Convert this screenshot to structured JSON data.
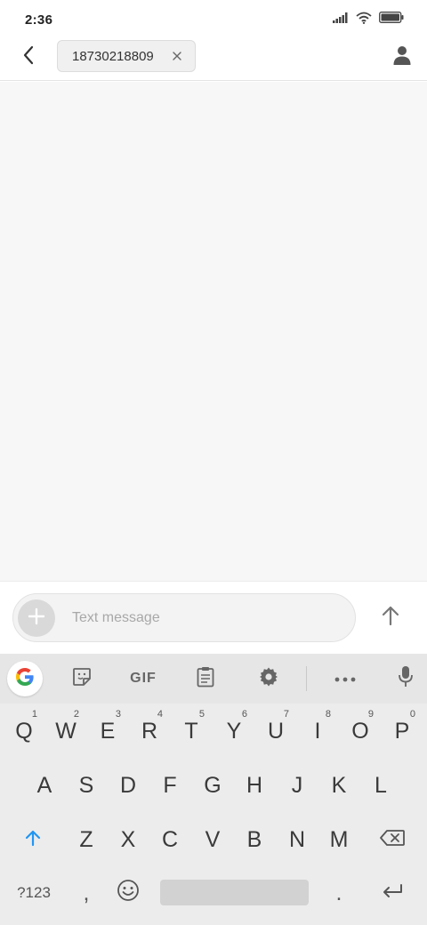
{
  "status_bar": {
    "time": "2:36",
    "icons": [
      "signal-icon",
      "wifi-icon",
      "battery-icon"
    ]
  },
  "header": {
    "back_icon": "back-arrow-icon",
    "recipient": "18730218809",
    "chip_close_icon": "close-icon",
    "contact_icon": "person-icon"
  },
  "composer": {
    "add_icon": "plus-icon",
    "placeholder": "Text message",
    "value": "",
    "send_icon": "arrow-up-icon"
  },
  "keyboard": {
    "toolbar": [
      "google-icon",
      "sticker-icon",
      "gif-icon",
      "clipboard-icon",
      "gear-icon",
      "more-icon",
      "microphone-icon"
    ],
    "gif_label": "GIF",
    "row1": [
      {
        "key": "Q",
        "hint": "1"
      },
      {
        "key": "W",
        "hint": "2"
      },
      {
        "key": "E",
        "hint": "3"
      },
      {
        "key": "R",
        "hint": "4"
      },
      {
        "key": "T",
        "hint": "5"
      },
      {
        "key": "Y",
        "hint": "6"
      },
      {
        "key": "U",
        "hint": "7"
      },
      {
        "key": "I",
        "hint": "8"
      },
      {
        "key": "O",
        "hint": "9"
      },
      {
        "key": "P",
        "hint": "0"
      }
    ],
    "row2": [
      "A",
      "S",
      "D",
      "F",
      "G",
      "H",
      "J",
      "K",
      "L"
    ],
    "row3": [
      "Z",
      "X",
      "C",
      "V",
      "B",
      "N",
      "M"
    ],
    "symbols_label": "?123",
    "comma": ",",
    "period": ".",
    "accent_color": "#2196f3"
  }
}
